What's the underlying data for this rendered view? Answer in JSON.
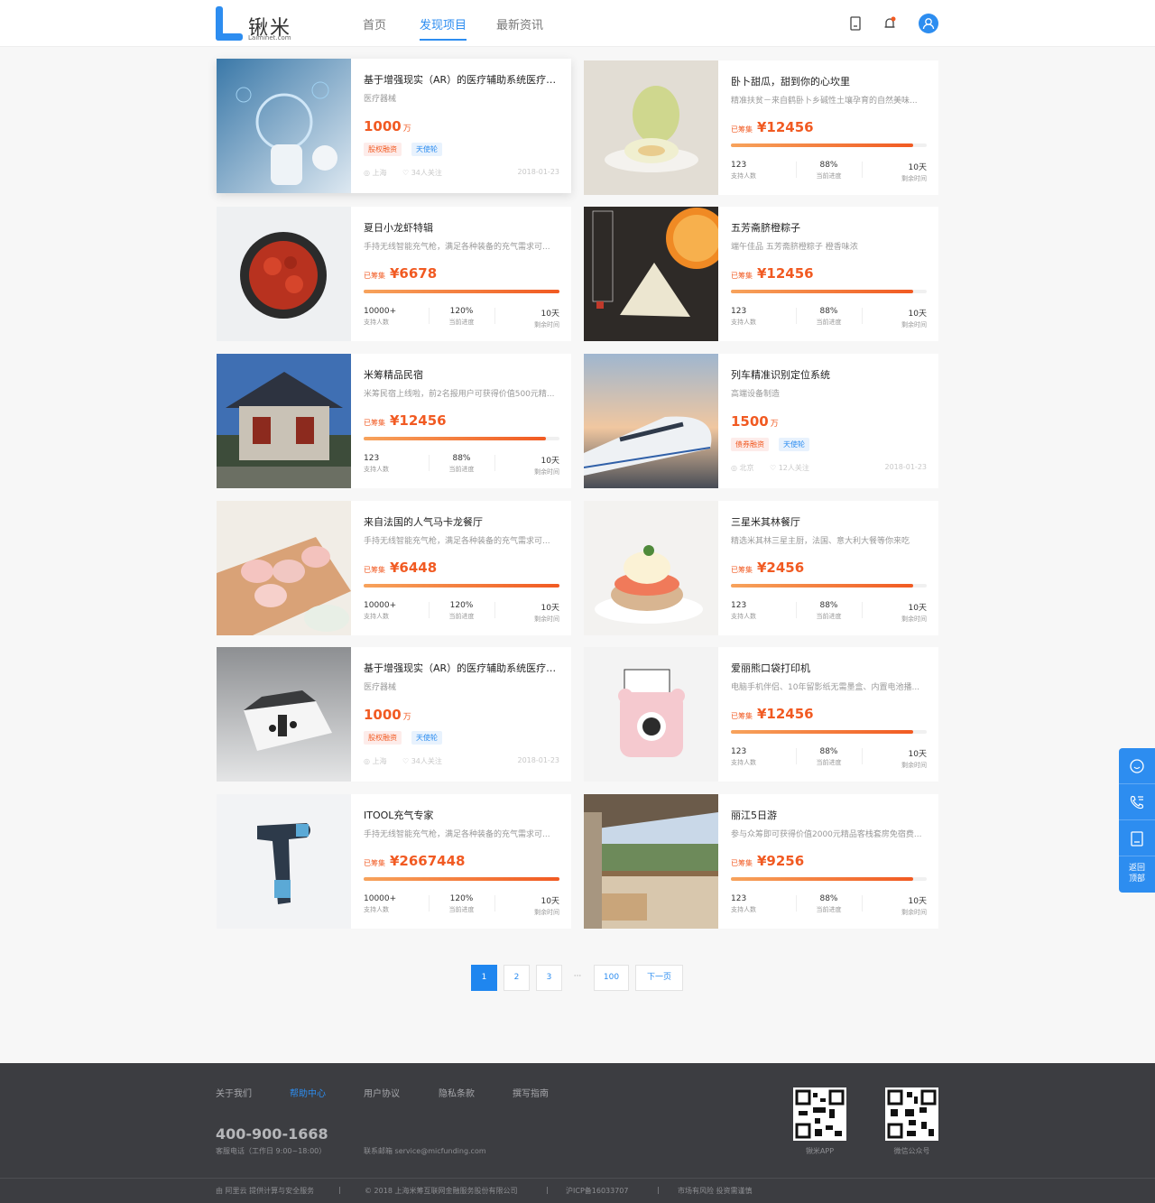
{
  "header": {
    "logo_name": "锹米",
    "logo_sub": "Laiminet.com",
    "nav": [
      "首页",
      "发现项目",
      "最新资讯"
    ],
    "active_nav": "发现项目",
    "icons": [
      "document-icon",
      "bell-icon",
      "user-icon"
    ],
    "accent": "#2d8df0"
  },
  "labels": {
    "raised": "已筹集",
    "backers": "支持人数",
    "progress": "当前进度",
    "remaining": "剩余时间",
    "unit": "万"
  },
  "cards": [
    {
      "title": "基于增强现实（AR）的医疗辅助系统医疗系...",
      "sub": "医疗器械",
      "kind": "equity",
      "amount": "1000",
      "tags": [
        "股权融资",
        "天使轮"
      ],
      "location": "上海",
      "follows": "34人关注",
      "date": "2018-01-23"
    },
    {
      "title": "卧卜甜瓜，甜到你的心坎里",
      "sub": "精准扶贫－来自鹤卧卜乡碱性土壤孕育的自然美味...",
      "kind": "crowd",
      "amount": "¥12456",
      "progress": 0.93,
      "backers": "123",
      "percent": "88%",
      "days": "10天"
    },
    {
      "title": "夏日小龙虾特辑",
      "sub": "手持无线智能充气枪，满足各种装备的充气需求可...",
      "kind": "crowd",
      "amount": "¥6678",
      "progress": 1.0,
      "backers": "10000+",
      "percent": "120%",
      "days": "10天"
    },
    {
      "title": "五芳斋脐橙粽子",
      "sub": "端午佳品 五芳斋脐橙粽子 橙香味浓",
      "kind": "crowd",
      "amount": "¥12456",
      "progress": 0.93,
      "backers": "123",
      "percent": "88%",
      "days": "10天"
    },
    {
      "title": "米筹精品民宿",
      "sub": "米筹民宿上线啦，前2名报用户可获得价值500元精...",
      "kind": "crowd",
      "amount": "¥12456",
      "progress": 0.93,
      "backers": "123",
      "percent": "88%",
      "days": "10天"
    },
    {
      "title": "列车精准识别定位系统",
      "sub": "高端设备制造",
      "kind": "equity",
      "amount": "1500",
      "tags": [
        "债券融资",
        "天使轮"
      ],
      "location": "北京",
      "follows": "12人关注",
      "date": "2018-01-23"
    },
    {
      "title": "来自法国的人气马卡龙餐厅",
      "sub": "手持无线智能充气枪，满足各种装备的充气需求可...",
      "kind": "crowd",
      "amount": "¥6448",
      "progress": 1.0,
      "backers": "10000+",
      "percent": "120%",
      "days": "10天"
    },
    {
      "title": "三星米其林餐厅",
      "sub": "精选米其林三星主厨，法国、意大利大餐等你来吃",
      "kind": "crowd",
      "amount": "¥2456",
      "progress": 0.93,
      "backers": "123",
      "percent": "88%",
      "days": "10天"
    },
    {
      "title": "基于增强现实（AR）的医疗辅助系统医疗系...",
      "sub": "医疗器械",
      "kind": "equity",
      "amount": "1000",
      "tags": [
        "股权融资",
        "天使轮"
      ],
      "location": "上海",
      "follows": "34人关注",
      "date": "2018-01-23"
    },
    {
      "title": "爱丽熊口袋打印机",
      "sub": "电脑手机伴侣、10年留影纸无需墨盒、内置电池播...",
      "kind": "crowd",
      "amount": "¥12456",
      "progress": 0.93,
      "backers": "123",
      "percent": "88%",
      "days": "10天"
    },
    {
      "title": "ITOOL充气专家",
      "sub": "手持无线智能充气枪，满足各种装备的充气需求可...",
      "kind": "crowd",
      "amount": "¥2667448",
      "progress": 1.0,
      "backers": "10000+",
      "percent": "120%",
      "days": "10天"
    },
    {
      "title": "丽江5日游",
      "sub": "参与众筹即可获得价值2000元精品客栈套房免宿费...",
      "kind": "crowd",
      "amount": "¥9256",
      "progress": 0.93,
      "backers": "123",
      "percent": "88%",
      "days": "10天"
    }
  ],
  "pagination": {
    "pages": [
      "1",
      "2",
      "3",
      "···",
      "100",
      "下一页"
    ],
    "current": "1"
  },
  "side_bar": {
    "icons": [
      "chat-icon",
      "phone-icon",
      "document-icon"
    ],
    "back_top": "返回顶部"
  },
  "footer": {
    "links": [
      "关于我们",
      "帮助中心",
      "用户协议",
      "隐私条款",
      "撰写指南"
    ],
    "active_link": "帮助中心",
    "phone": "400-900-1668",
    "phone_note": "客服电话（工作日 9:00~18:00）",
    "email": "联系邮箱 service@micfunding.com",
    "qr": [
      "锹米APP",
      "微信公众号"
    ],
    "bottom": [
      "由 阿里云 提供计算与安全服务",
      "|",
      "© 2018 上海米筹互联网金融服务股份有限公司",
      "|",
      "沪ICP备16033707",
      "|",
      "市场有风险 投资需谨慎"
    ]
  }
}
